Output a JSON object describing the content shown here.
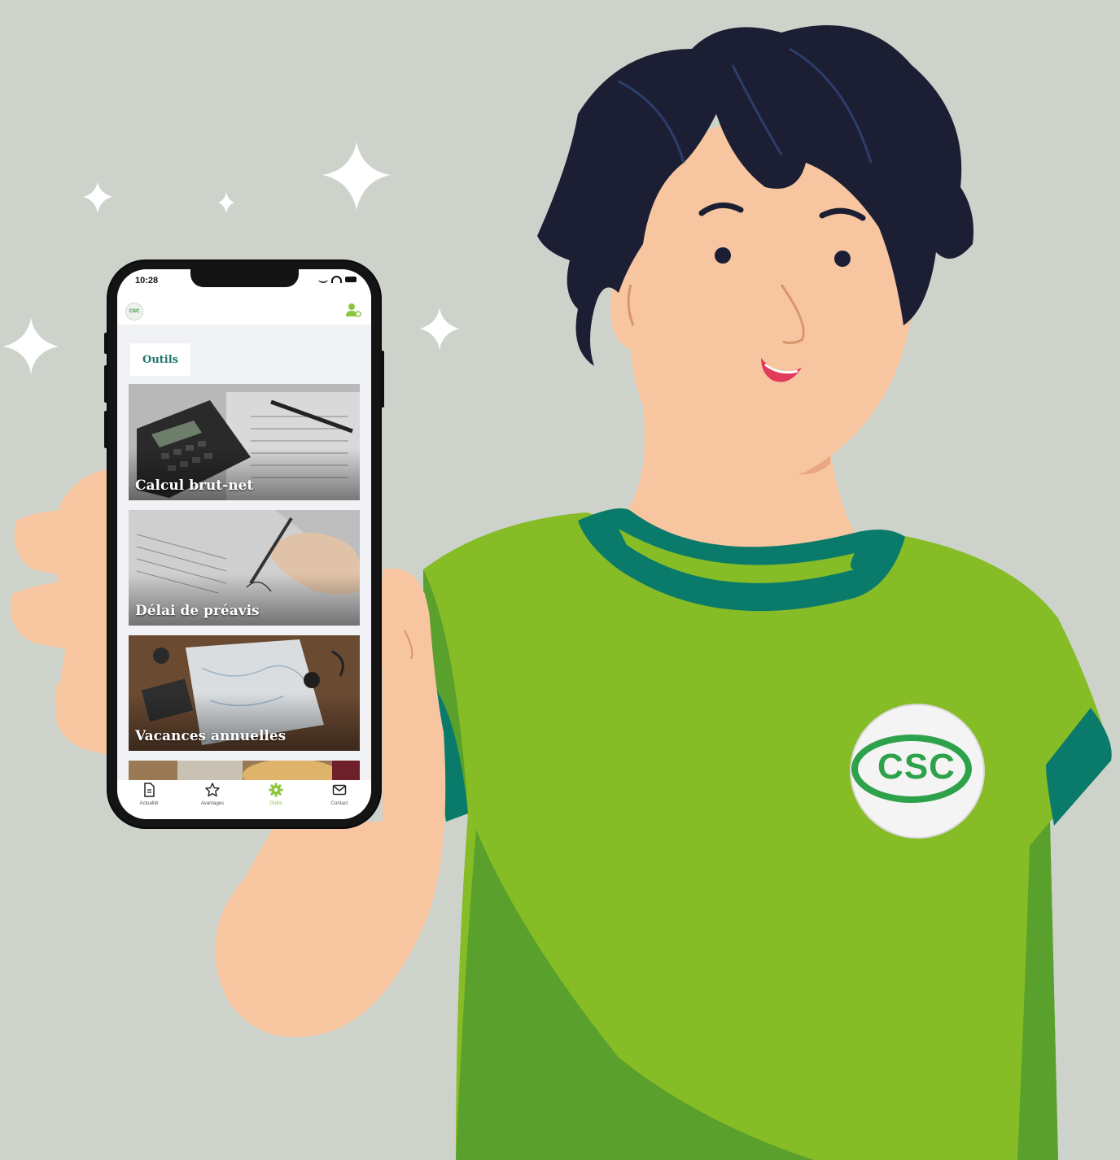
{
  "colors": {
    "background": "#cdd3cb",
    "shirt": "#86bc25",
    "shirt_shadow": "#5aa02c",
    "collar": "#0a7a6a",
    "skin": "#f7c5a0",
    "hair": "#1c1f33",
    "accent": "#8cc63f"
  },
  "status_bar": {
    "time": "10:28"
  },
  "app_bar": {
    "logo_icon": "csc-logo",
    "profile_icon": "user-settings-icon"
  },
  "section_tab": {
    "label": "Outils"
  },
  "cards": [
    {
      "title": "Calcul brut-net",
      "image": "calculator-documents"
    },
    {
      "title": "Délai de préavis",
      "image": "signing-document"
    },
    {
      "title": "Vacances annuelles",
      "image": "travel-map-desk"
    },
    {
      "title": "",
      "image": "coins-partial"
    }
  ],
  "bottom_nav": [
    {
      "label": "Actualité",
      "icon": "document-icon",
      "active": false
    },
    {
      "label": "Avantages",
      "icon": "star-icon",
      "active": false
    },
    {
      "label": "Outils",
      "icon": "gear-icon",
      "active": true
    },
    {
      "label": "Contact",
      "icon": "envelope-icon",
      "active": false
    }
  ],
  "badge": {
    "text": "CSC"
  }
}
